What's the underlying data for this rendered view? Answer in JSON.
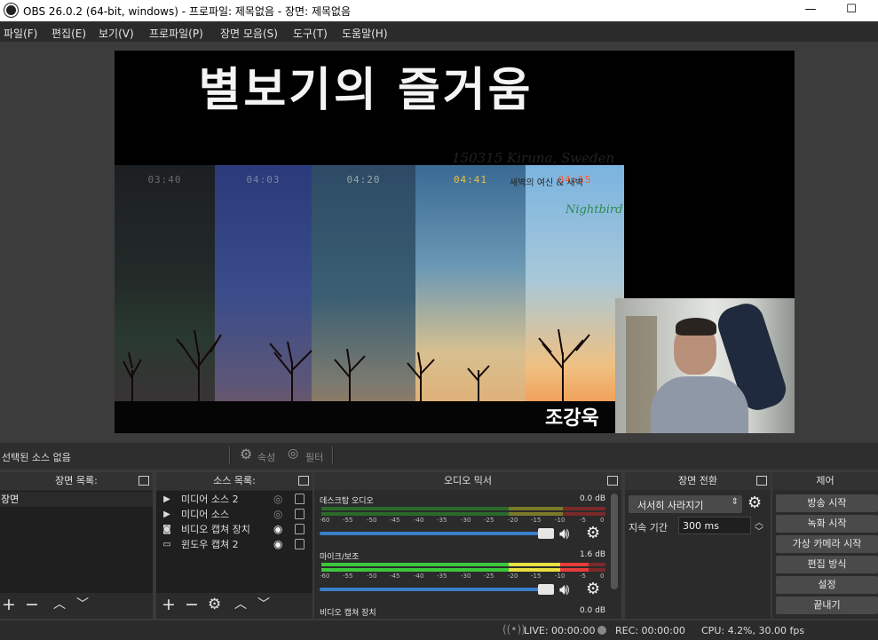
{
  "window": {
    "title": "OBS 26.0.2 (64-bit, windows) - 프로파일: 제목없음 - 장면: 제목없음",
    "minimize": "—",
    "maximize": "☐"
  },
  "menu": [
    "파일(F)",
    "편집(E)",
    "보기(V)",
    "프로파일(P)",
    "장면 모음(S)",
    "도구(T)",
    "도움말(H)"
  ],
  "preview": {
    "title": "별보기의 즐거움",
    "panels": [
      {
        "time": "03:40",
        "time_color": "#6a6a6a"
      },
      {
        "time": "04:03",
        "time_color": "#7a84a0"
      },
      {
        "time": "04:20",
        "time_color": "#9aa6a6"
      },
      {
        "time": "04:41",
        "time_color": "#e8c040"
      },
      {
        "time": "04:55",
        "time_color": "#f0603a"
      }
    ],
    "note_line1": "150315 Kiruna, Sweden",
    "note_line2": "새벽의 여신 & 새벽",
    "signature": "Nightbird",
    "name_caption": "조강욱"
  },
  "status": {
    "no_source": "선택된 소스 없음",
    "properties": "속성",
    "filters": "필터"
  },
  "scenes": {
    "header": "장면 목록:",
    "items": [
      "장면"
    ]
  },
  "sources": {
    "header": "소스 목록:",
    "items": [
      {
        "label": "미디어 소스 2",
        "icon": "play-icon",
        "visible": false
      },
      {
        "label": "미디어 소스",
        "icon": "play-icon",
        "visible": false
      },
      {
        "label": "비디오 캡쳐 장치",
        "icon": "camera-icon",
        "visible": true
      },
      {
        "label": "윈도우 캡쳐 2",
        "icon": "window-icon",
        "visible": true
      }
    ]
  },
  "mixer": {
    "header": "오디오 믹서",
    "tracks": [
      {
        "name": "데스크탑 오디오",
        "db": "0.0 dB"
      },
      {
        "name": "마이크/보조",
        "db": "1.6 dB"
      },
      {
        "name": "비디오 캡쳐 장치",
        "db": "0.0 dB"
      }
    ],
    "scale": [
      "-60",
      "-55",
      "-50",
      "-45",
      "-40",
      "-35",
      "-30",
      "-25",
      "-20",
      "-15",
      "-10",
      "-5",
      "0"
    ]
  },
  "transitions": {
    "header": "장면 전환",
    "selected": "서서히 사라지기",
    "duration_label": "지속 기간",
    "duration": "300 ms"
  },
  "controls": {
    "header": "제어",
    "buttons": [
      "방송 시작",
      "녹화 시작",
      "가상 카메라 시작",
      "편집 방식",
      "설정",
      "끝내기"
    ]
  },
  "footer": {
    "live": "LIVE: 00:00:00",
    "rec": "REC: 00:00:00",
    "cpu": "CPU: 4.2%, 30.00 fps"
  }
}
